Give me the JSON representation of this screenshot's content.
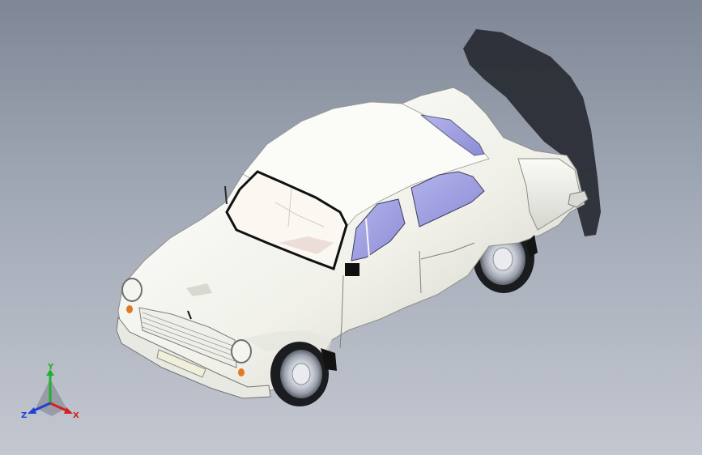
{
  "viewport": {
    "background_top": "#7f8796",
    "background_bottom": "#c3c7d0"
  },
  "model": {
    "object": "car-model",
    "body_color": "#f3f3ee",
    "glass_color": "#9c9ce0",
    "shadow_color": "#2a2d35"
  },
  "triad": {
    "x_label": "X",
    "y_label": "Y",
    "z_label": "Z",
    "x_color": "#d42020",
    "y_color": "#20b030",
    "z_color": "#2040d0"
  }
}
